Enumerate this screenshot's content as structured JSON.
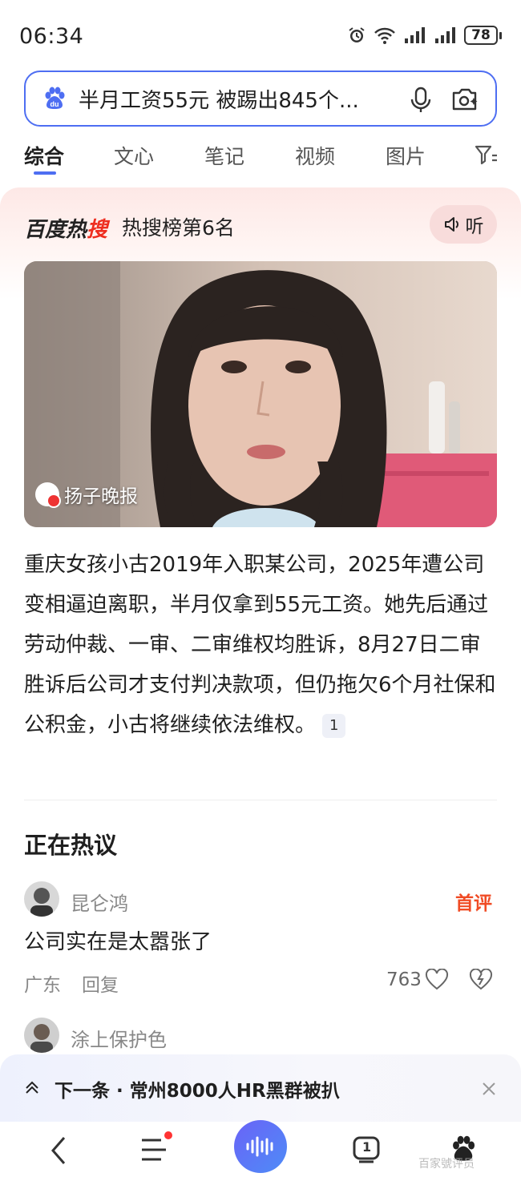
{
  "status_bar": {
    "time": "06:34",
    "battery": "78"
  },
  "search": {
    "query": "半月工资55元 被踢出845个..."
  },
  "tabs": [
    {
      "label": "综合",
      "active": true
    },
    {
      "label": "文心",
      "active": false
    },
    {
      "label": "笔记",
      "active": false
    },
    {
      "label": "视频",
      "active": false
    },
    {
      "label": "图片",
      "active": false
    }
  ],
  "hot": {
    "brand_black": "百度热",
    "brand_red": "搜",
    "rank_text": "热搜榜第6名",
    "listen_label": "听"
  },
  "video": {
    "source": "扬子晚报"
  },
  "summary": {
    "text": "重庆女孩小古2019年入职某公司，2025年遭公司变相逼迫离职，半月仅拿到55元工资。她先后通过劳动仲裁、一审、二审维权均胜诉，8月27日二审胜诉后公司才支付判决款项，但仍拖欠6个月社保和公积金，小古将继续依法维权。",
    "citation": "1"
  },
  "discussion": {
    "title": "正在热议",
    "comments": [
      {
        "user": "昆仑鸿",
        "badge": "首评",
        "text": "公司实在是太嚣张了",
        "location": "广东",
        "reply_label": "回复",
        "likes": "763"
      },
      {
        "user": "涂上保护色"
      }
    ]
  },
  "next": {
    "text": "下一条 · 常州8000人HR黑群被扒"
  },
  "bottom_nav": {
    "tab_count": "1"
  },
  "watermark": "百家號评员",
  "colors": {
    "accent": "#4e6ef2",
    "brand_red": "#ee2d1f",
    "badge_orange": "#f04b24"
  }
}
